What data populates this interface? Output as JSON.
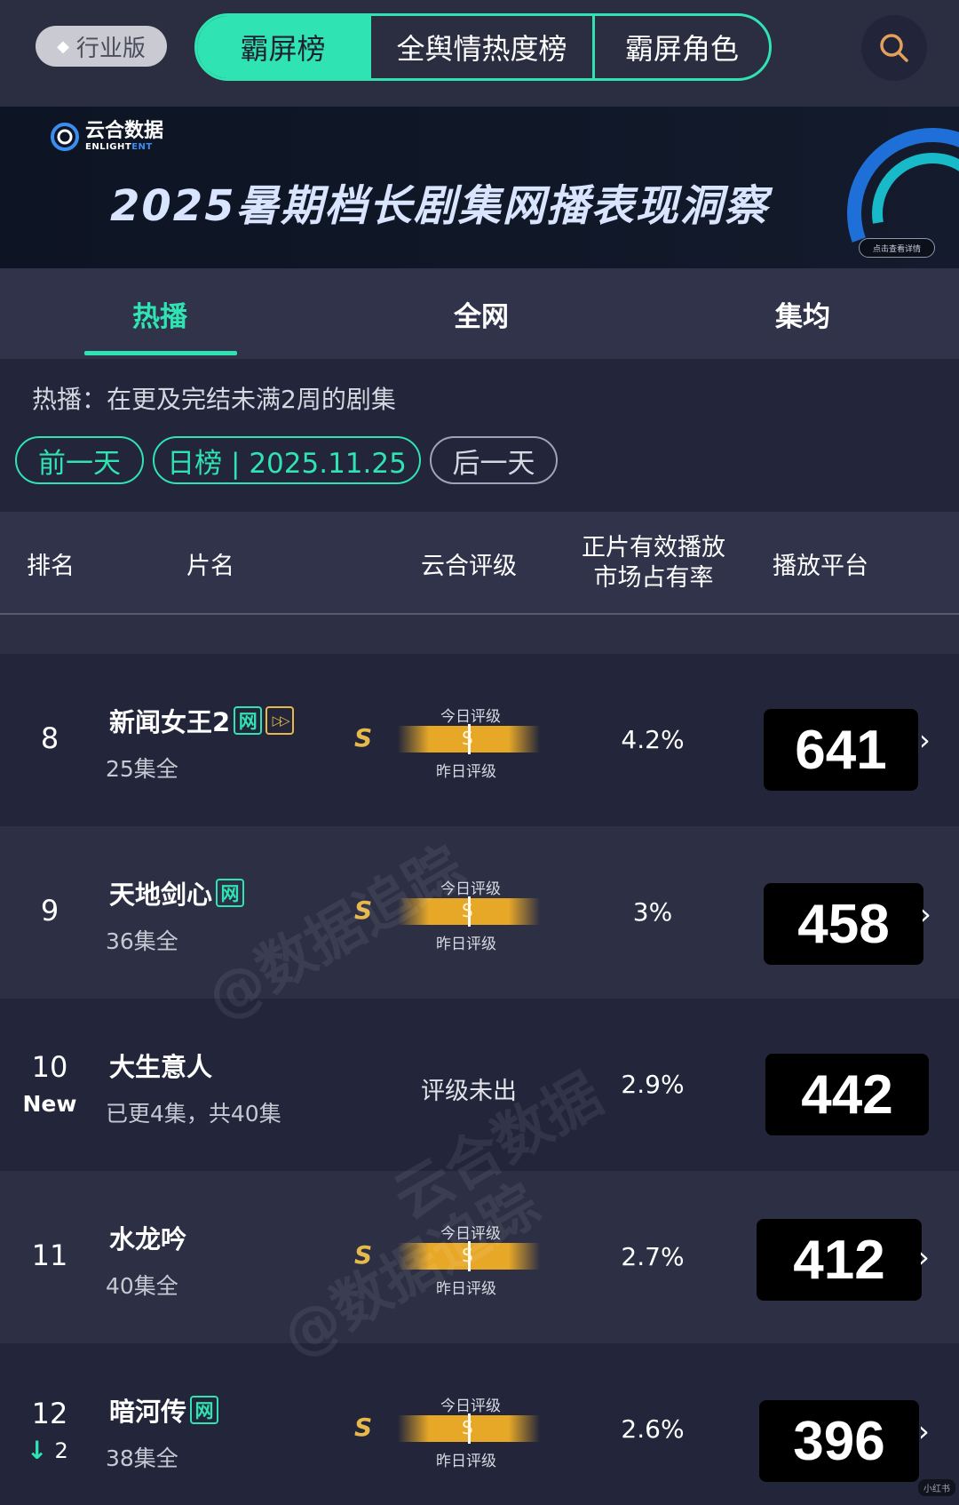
{
  "header": {
    "edition_label": "行业版",
    "tabs": [
      "霸屏榜",
      "全舆情热度榜",
      "霸屏角色"
    ],
    "active_tab": "霸屏榜"
  },
  "banner": {
    "brand_cn": "云合数据",
    "brand_en_a": "ENLIGHT",
    "brand_en_b": "ENT",
    "title": "2025暑期档长剧集网播表现洞察",
    "button": "点击查看详情"
  },
  "subtabs": [
    "热播",
    "全网",
    "集均"
  ],
  "info_text": "热播：在更及完结未满2周的剧集",
  "date_nav": {
    "prev": "前一天",
    "current": "日榜 | 2025.11.25",
    "next": "后一天"
  },
  "table_header": {
    "rank": "排名",
    "title": "片名",
    "grade": "云合评级",
    "share_line1": "正片有效播放",
    "share_line2": "市场占有率",
    "platform": "播放平台"
  },
  "grade_labels": {
    "today": "今日评级",
    "yesterday": "昨日评级",
    "none": "评级未出"
  },
  "rows": [
    {
      "rank": "8",
      "title": "新闻女王2",
      "tag": "网",
      "episodes": "25集全",
      "grade": "S",
      "grade_mark": "S",
      "share": "4.2%",
      "platform": "641"
    },
    {
      "rank": "9",
      "title": "天地剑心",
      "tag": "网",
      "episodes": "36集全",
      "grade": "S",
      "grade_mark": "S",
      "share": "3%",
      "platform": "458"
    },
    {
      "rank": "10",
      "badge": "New",
      "title": "大生意人",
      "episodes": "已更4集，共40集",
      "share": "2.9%",
      "platform": "442"
    },
    {
      "rank": "11",
      "title": "水龙吟",
      "episodes": "40集全",
      "grade": "S",
      "grade_mark": "S",
      "share": "2.7%",
      "platform": "412"
    },
    {
      "rank": "12",
      "change": "2",
      "title": "暗河传",
      "tag": "网",
      "episodes": "38集全",
      "grade": "S",
      "grade_mark": "S",
      "share": "2.6%",
      "platform": "396"
    }
  ],
  "watermarks": {
    "w1": "@数据追踪",
    "w2": "云合数据",
    "w3": "@数据追踪"
  },
  "corner_badge": "小红书",
  "colors": {
    "accent": "#2fe3b2",
    "background": "#23263a",
    "grade_gold": "#e7b84a"
  },
  "icons": {
    "search": "search-icon",
    "gem": "gem-icon",
    "chevron": "chevron-right-icon",
    "down_arrow": "arrow-down-icon"
  }
}
